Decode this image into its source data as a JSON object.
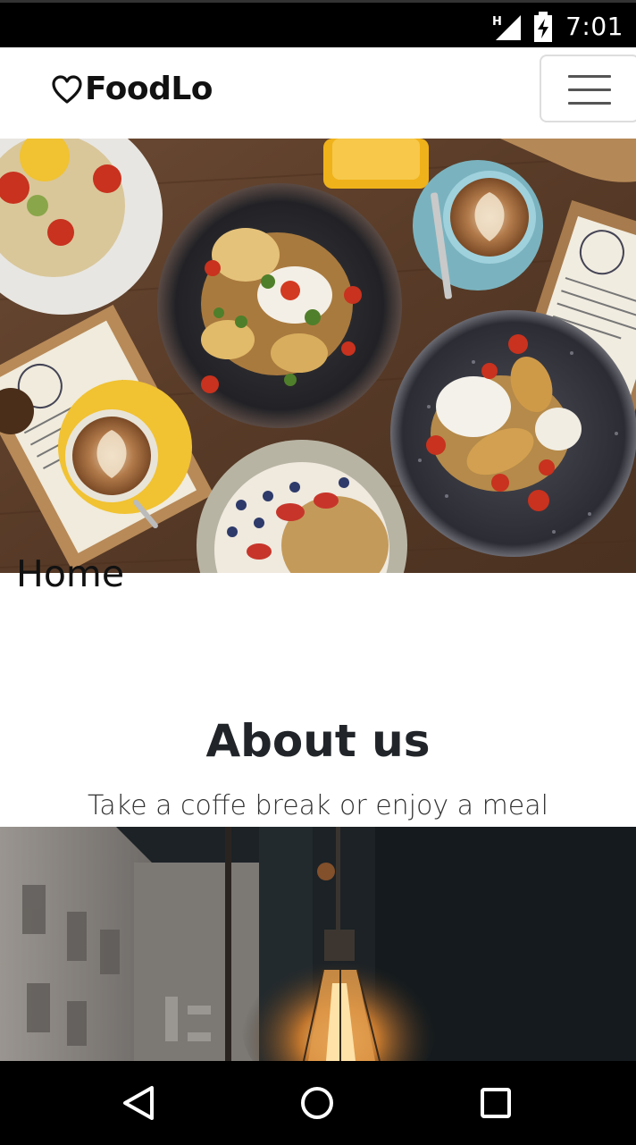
{
  "status_bar": {
    "time": "7:01",
    "network_label": "H",
    "icons": [
      "signal-icon",
      "battery-charging-icon"
    ]
  },
  "navbar": {
    "brand_name": "FoodLo",
    "brand_icon": "heart-outline-icon",
    "menu_icon": "hamburger-menu-icon"
  },
  "hero": {
    "image_description_icon": "food-table-photo",
    "heading": "Home"
  },
  "about": {
    "title": "About us",
    "subtitle": "Take a coffe break or enjoy a meal"
  },
  "lamp_section": {
    "image_icon": "cafe-lamp-photo"
  },
  "system_nav": {
    "icons": [
      "back-icon",
      "home-icon",
      "recents-icon"
    ]
  },
  "colors": {
    "text_dark": "#212529",
    "brand_text": "#111111",
    "toggler_border": "#dddddd",
    "toggler_bar": "#555555"
  }
}
